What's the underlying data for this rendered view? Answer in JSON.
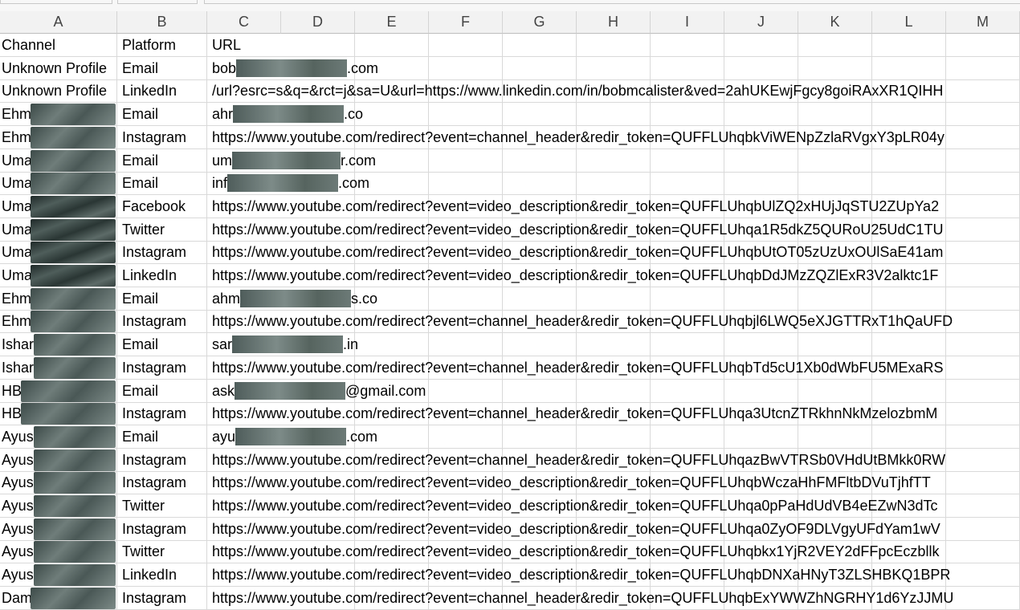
{
  "columns": [
    "A",
    "B",
    "C",
    "D",
    "E",
    "F",
    "G",
    "H",
    "I",
    "J",
    "K",
    "L",
    "M"
  ],
  "rows": [
    {
      "a": "Channel",
      "b": "Platform",
      "c": "URL"
    },
    {
      "a": "Unknown Profile",
      "b": "Email",
      "c": "bob",
      "tail": ".com"
    },
    {
      "a": "Unknown Profile",
      "b": "LinkedIn",
      "c": "/url?esrc=s&q=&rct=j&sa=U&url=https://www.linkedin.com/in/bobmcalister&ved=2ahUKEwjFgcy8goiRAxXR1QIHH"
    },
    {
      "a": "Ehm",
      "b": "Email",
      "c": "ahr",
      "tail": ".co"
    },
    {
      "a": "Ehm",
      "b": "Instagram",
      "c": "https://www.youtube.com/redirect?event=channel_header&redir_token=QUFFLUhqbkViWENpZzlaRVgxY3pLR04y"
    },
    {
      "a": "Uma",
      "b": "Email",
      "c": "um",
      "tail": "r.com"
    },
    {
      "a": "Uma",
      "b": "Email",
      "c": "inf",
      "tail": ".com"
    },
    {
      "a": "Uma",
      "b": "Facebook",
      "c": "https://www.youtube.com/redirect?event=video_description&redir_token=QUFFLUhqbUlZQ2xHUjJqSTU2ZUpYa2"
    },
    {
      "a": "Uma",
      "b": "Twitter",
      "c": "https://www.youtube.com/redirect?event=video_description&redir_token=QUFFLUhqa1R5dkZ5QURoU25UdC1TU"
    },
    {
      "a": "Uma",
      "b": "Instagram",
      "c": "https://www.youtube.com/redirect?event=video_description&redir_token=QUFFLUhqbUtOT05zUzUxOUlSaE41am"
    },
    {
      "a": "Uma",
      "b": "LinkedIn",
      "c": "https://www.youtube.com/redirect?event=video_description&redir_token=QUFFLUhqbDdJMzZQZlExR3V2alktc1F"
    },
    {
      "a": "Ehm",
      "b": "Email",
      "c": "ahm",
      "tail": "s.co"
    },
    {
      "a": "Ehm",
      "b": "Instagram",
      "c": "https://www.youtube.com/redirect?event=channel_header&redir_token=QUFFLUhqbjl6LWQ5eXJGTTRxT1hQaUFD"
    },
    {
      "a": "Ishar",
      "b": "Email",
      "c": "sar",
      "tail": ".in"
    },
    {
      "a": "Ishar",
      "b": "Instagram",
      "c": "https://www.youtube.com/redirect?event=channel_header&redir_token=QUFFLUhqbTd5cU1Xb0dWbFU5MExaRS"
    },
    {
      "a": "HB",
      "b": "Email",
      "c": "ask",
      "tail": "@gmail.com"
    },
    {
      "a": "HB",
      "b": "Instagram",
      "c": "https://www.youtube.com/redirect?event=channel_header&redir_token=QUFFLUhqa3UtcnZTRkhnNkMzelozbmM"
    },
    {
      "a": "Ayus",
      "b": "Email",
      "c": "ayu",
      "tail": ".com"
    },
    {
      "a": "Ayus",
      "b": "Instagram",
      "c": "https://www.youtube.com/redirect?event=channel_header&redir_token=QUFFLUhqazBwVTRSb0VHdUtBMkk0RW"
    },
    {
      "a": "Ayus",
      "b": "Instagram",
      "c": "https://www.youtube.com/redirect?event=video_description&redir_token=QUFFLUhqbWczaHhFMFltbDVuTjhfTT"
    },
    {
      "a": "Ayus",
      "b": "Twitter",
      "c": "https://www.youtube.com/redirect?event=video_description&redir_token=QUFFLUhqa0pPaHdUdVB4eEZwN3dTc"
    },
    {
      "a": "Ayus",
      "b": "Instagram",
      "c": "https://www.youtube.com/redirect?event=video_description&redir_token=QUFFLUhqa0ZyOF9DLVgyUFdYam1wV"
    },
    {
      "a": "Ayus",
      "b": "Twitter",
      "c": "https://www.youtube.com/redirect?event=video_description&redir_token=QUFFLUhqbkx1YjR2VEY2dFFpcEczbllk"
    },
    {
      "a": "Ayus",
      "b": "LinkedIn",
      "c": "https://www.youtube.com/redirect?event=video_description&redir_token=QUFFLUhqbDNXaHNyT3ZLSHBKQ1BPR"
    },
    {
      "a": "Dam",
      "b": "Instagram",
      "c": "https://www.youtube.com/redirect?event=channel_header&redir_token=QUFFLUhqbExYWWZhNGRHY1d6YzJJMU"
    }
  ]
}
